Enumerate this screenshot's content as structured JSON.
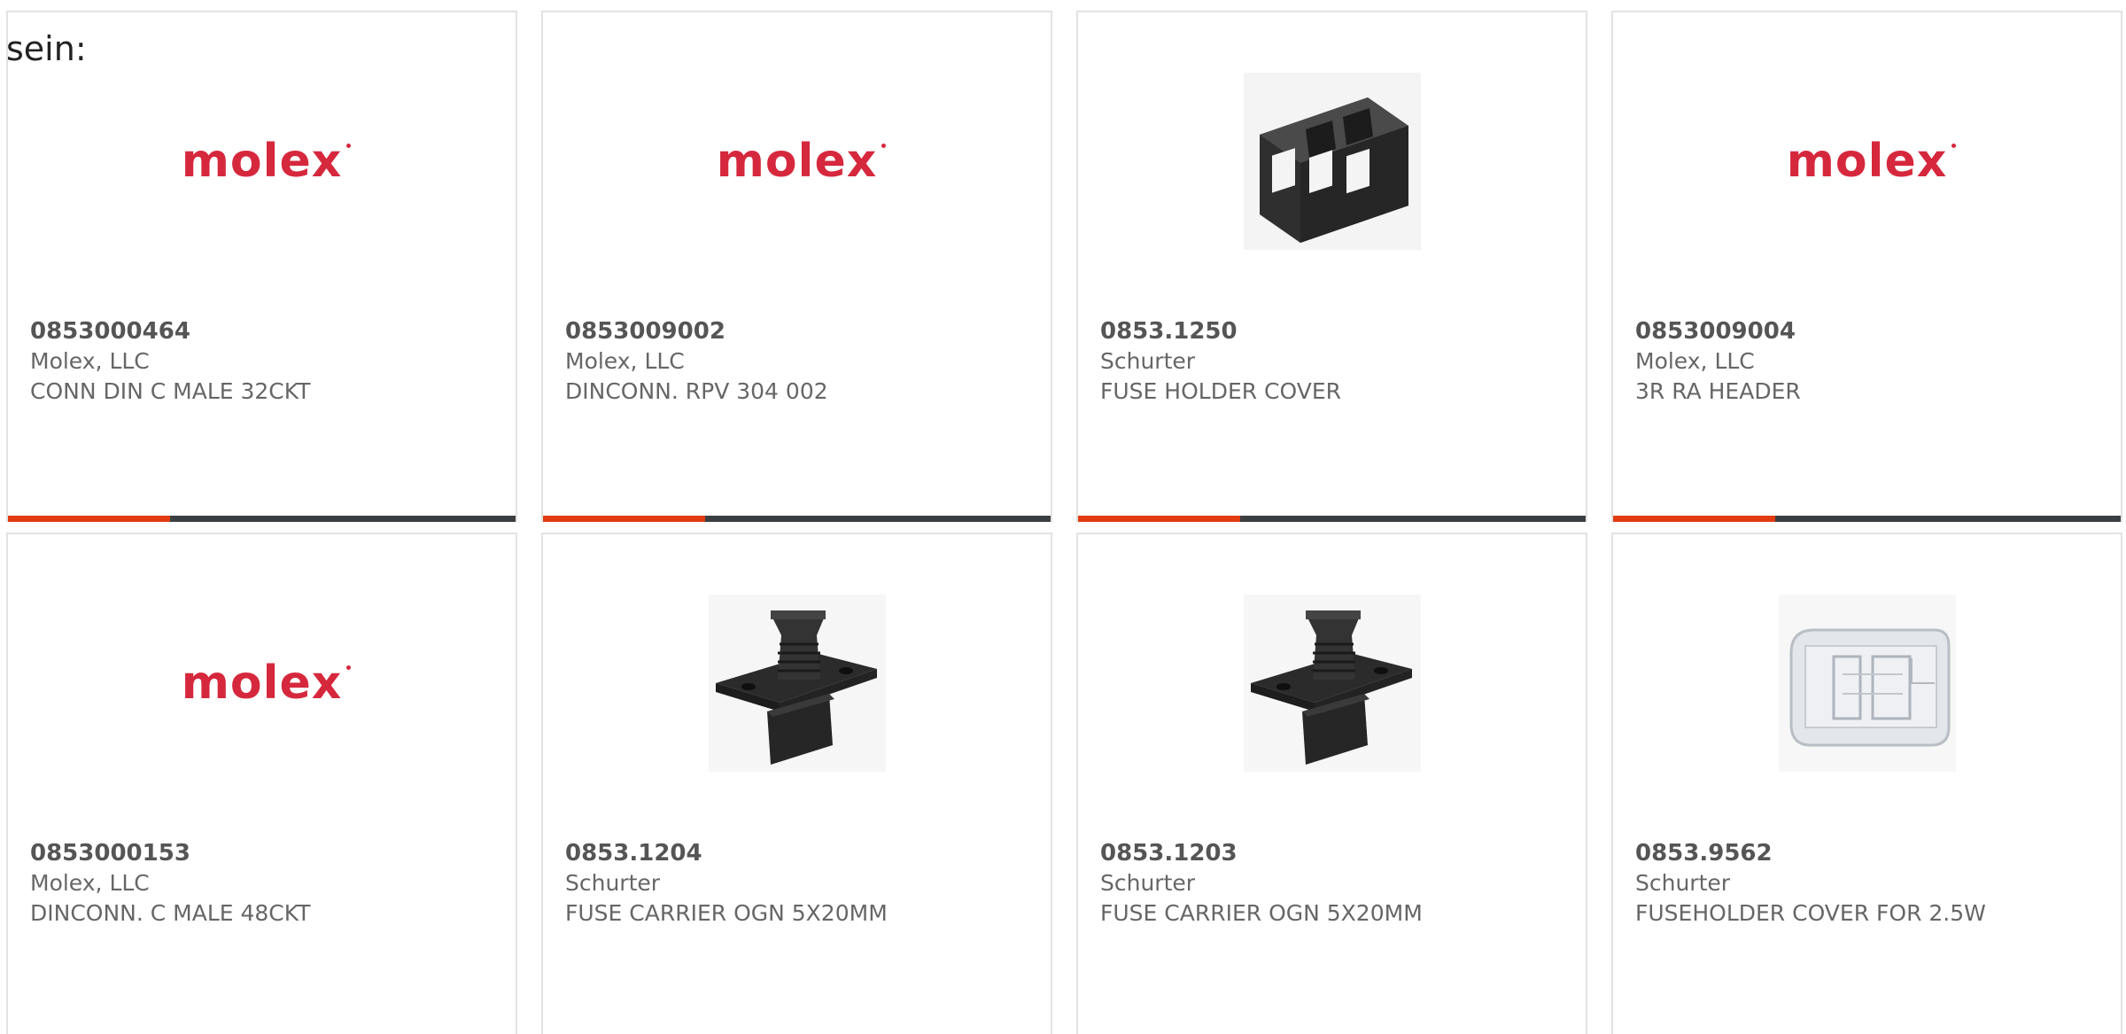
{
  "intro_text": "sein:",
  "accent_color": "#e03c10",
  "bar_color": "#3b3f42",
  "brand_color": "#d6283d",
  "cards": [
    {
      "image": "molex-logo",
      "logo_text": "molex",
      "mpn": "0853000464",
      "manufacturer": "Molex, LLC",
      "description": "CONN DIN C MALE 32CKT"
    },
    {
      "image": "molex-logo",
      "logo_text": "molex",
      "mpn": "0853009002",
      "manufacturer": "Molex, LLC",
      "description": "DINCONN. RPV 304 002"
    },
    {
      "image": "fuse-holder-cover-photo",
      "mpn": "0853.1250",
      "manufacturer": "Schurter",
      "description": "FUSE HOLDER COVER"
    },
    {
      "image": "molex-logo",
      "logo_text": "molex",
      "mpn": "0853009004",
      "manufacturer": "Molex, LLC",
      "description": "3R RA HEADER"
    },
    {
      "image": "molex-logo",
      "logo_text": "molex",
      "mpn": "0853000153",
      "manufacturer": "Molex, LLC",
      "description": "DINCONN. C MALE 48CKT"
    },
    {
      "image": "fuse-carrier-photo",
      "mpn": "0853.1204",
      "manufacturer": "Schurter",
      "description": "FUSE CARRIER OGN 5X20MM"
    },
    {
      "image": "fuse-carrier-photo",
      "mpn": "0853.1203",
      "manufacturer": "Schurter",
      "description": "FUSE CARRIER OGN 5X20MM"
    },
    {
      "image": "fuseholder-cover-clear-photo",
      "mpn": "0853.9562",
      "manufacturer": "Schurter",
      "description": "FUSEHOLDER COVER FOR 2.5W"
    }
  ]
}
